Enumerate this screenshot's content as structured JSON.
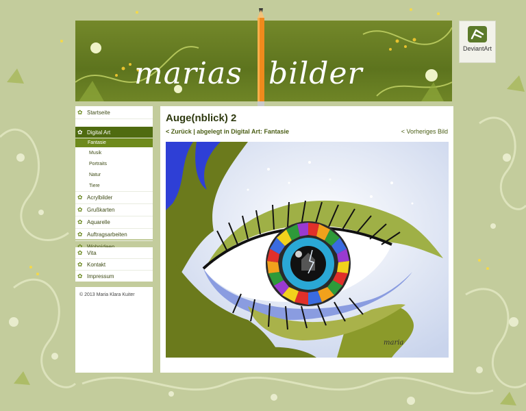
{
  "header": {
    "logo_left": "marias",
    "logo_right": "bilder"
  },
  "deviantart": {
    "label": "DeviantArt"
  },
  "sidebar": {
    "main_items": [
      {
        "label": "Startseite"
      }
    ],
    "digital_art": {
      "label": "Digital Art",
      "subitems": [
        "Fantasie",
        "Musik",
        "Portraits",
        "Natur",
        "Tiere"
      ]
    },
    "more_items": [
      "Acrylbilder",
      "Grußkarten",
      "Aquarelle",
      "Auftragsarbeiten",
      "Wohnideen"
    ],
    "info_items": [
      "Vita",
      "Kontakt",
      "Impressum"
    ],
    "copyright": "© 2013 Maria Klara Kuiter"
  },
  "content": {
    "title": "Auge(nblick) 2",
    "breadcrumb": "< Zurück | abgelegt in Digital Art: Fantasie",
    "prev_link": "< Vorheriges Bild",
    "signature": "maria"
  },
  "colors": {
    "accent_dark": "#4f6b10",
    "accent": "#6e8a1c",
    "background": "#c3cc9c"
  }
}
